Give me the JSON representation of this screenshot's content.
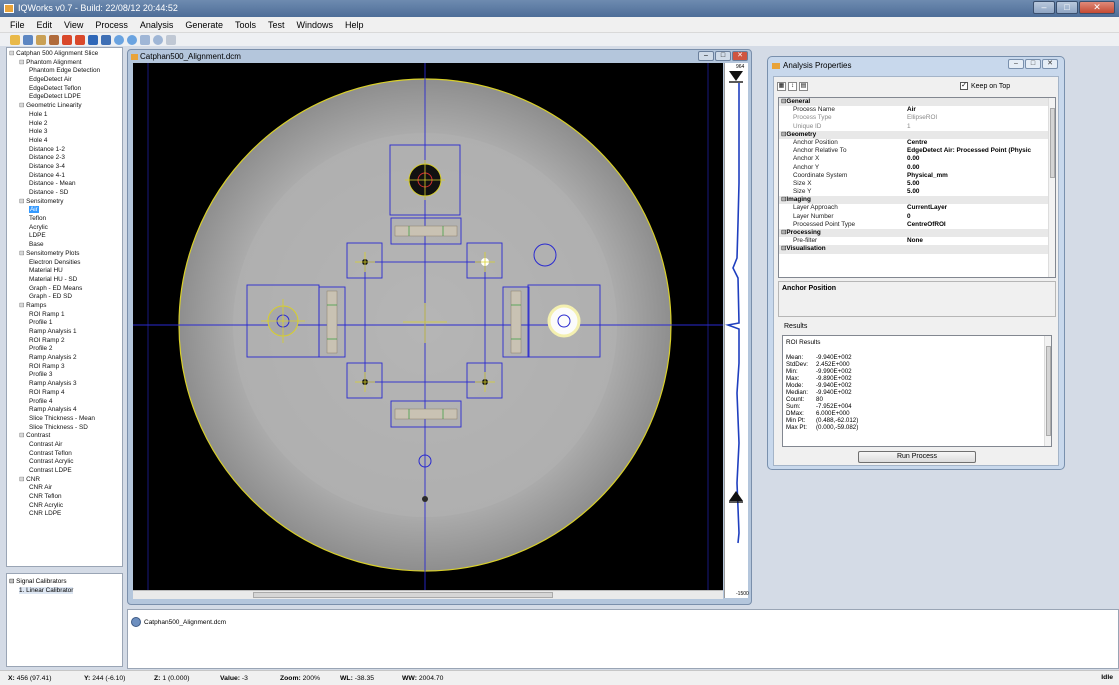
{
  "window": {
    "title": "IQWorks v0.7 - Build: 22/08/12 20:44:52"
  },
  "menu": [
    "File",
    "Edit",
    "View",
    "Process",
    "Analysis",
    "Generate",
    "Tools",
    "Test",
    "Windows",
    "Help"
  ],
  "tree": [
    {
      "label": "Catphan 500 Alignment Slice",
      "level": 0,
      "exp": true
    },
    {
      "label": "Phantom Alignment",
      "level": 1,
      "exp": true
    },
    {
      "label": "Phantom Edge Detection",
      "level": 2
    },
    {
      "label": "EdgeDetect Air",
      "level": 2
    },
    {
      "label": "EdgeDetect Teflon",
      "level": 2
    },
    {
      "label": "EdgeDetect LDPE",
      "level": 2
    },
    {
      "label": "Geometric Linearity",
      "level": 1,
      "exp": true
    },
    {
      "label": "Hole 1",
      "level": 2
    },
    {
      "label": "Hole 2",
      "level": 2
    },
    {
      "label": "Hole 3",
      "level": 2
    },
    {
      "label": "Hole 4",
      "level": 2
    },
    {
      "label": "Distance 1-2",
      "level": 2
    },
    {
      "label": "Distance 2-3",
      "level": 2
    },
    {
      "label": "Distance 3-4",
      "level": 2
    },
    {
      "label": "Distance 4-1",
      "level": 2
    },
    {
      "label": "Distance - Mean",
      "level": 2
    },
    {
      "label": "Distance - SD",
      "level": 2
    },
    {
      "label": "Sensitometry",
      "level": 1,
      "exp": true
    },
    {
      "label": "Air",
      "level": 2,
      "sel": true
    },
    {
      "label": "Teflon",
      "level": 2
    },
    {
      "label": "Acrylic",
      "level": 2
    },
    {
      "label": "LDPE",
      "level": 2
    },
    {
      "label": "Base",
      "level": 2
    },
    {
      "label": "Sensitometry Plots",
      "level": 1,
      "exp": true
    },
    {
      "label": "Electron Densities",
      "level": 2
    },
    {
      "label": "Material HU",
      "level": 2
    },
    {
      "label": "Material HU - SD",
      "level": 2
    },
    {
      "label": "Graph - ED Means",
      "level": 2
    },
    {
      "label": "Graph - ED SD",
      "level": 2
    },
    {
      "label": "Ramps",
      "level": 1,
      "exp": true
    },
    {
      "label": "ROI Ramp 1",
      "level": 2
    },
    {
      "label": "Profile 1",
      "level": 2
    },
    {
      "label": "Ramp Analysis 1",
      "level": 2
    },
    {
      "label": "ROI Ramp 2",
      "level": 2
    },
    {
      "label": "Profile 2",
      "level": 2
    },
    {
      "label": "Ramp Analysis 2",
      "level": 2
    },
    {
      "label": "ROI Ramp 3",
      "level": 2
    },
    {
      "label": "Profile 3",
      "level": 2
    },
    {
      "label": "Ramp Analysis 3",
      "level": 2
    },
    {
      "label": "ROI Ramp 4",
      "level": 2
    },
    {
      "label": "Profile 4",
      "level": 2
    },
    {
      "label": "Ramp Analysis 4",
      "level": 2
    },
    {
      "label": "Slice Thickness - Mean",
      "level": 2
    },
    {
      "label": "Slice Thickness - SD",
      "level": 2
    },
    {
      "label": "Contrast",
      "level": 1,
      "exp": true
    },
    {
      "label": "Contrast Air",
      "level": 2
    },
    {
      "label": "Contrast Teflon",
      "level": 2
    },
    {
      "label": "Contrast Acrylic",
      "level": 2
    },
    {
      "label": "Contrast LDPE",
      "level": 2
    },
    {
      "label": "CNR",
      "level": 1,
      "exp": true
    },
    {
      "label": "CNR Air",
      "level": 2
    },
    {
      "label": "CNR Teflon",
      "level": 2
    },
    {
      "label": "CNR Acrylic",
      "level": 2
    },
    {
      "label": "CNR LDPE",
      "level": 2
    }
  ],
  "calibrators": {
    "root": "Signal Calibrators",
    "item": "1. Linear Calibrator"
  },
  "image_window": {
    "title": "Catphan500_Alignment.dcm",
    "profile_top": "964",
    "profile_bottom": "-1500"
  },
  "analysis": {
    "title": "Analysis Properties",
    "keep_on_top": "Keep on Top",
    "rows": [
      {
        "cat": "General"
      },
      {
        "k": "Process Name",
        "v": "Air"
      },
      {
        "k": "Process Type",
        "v": "EllipseROI",
        "dis": true
      },
      {
        "k": "Unique ID",
        "v": "1",
        "dis": true
      },
      {
        "cat": "Geometry"
      },
      {
        "k": "Anchor Position",
        "v": "Centre"
      },
      {
        "k": "Anchor Relative To",
        "v": "EdgeDetect Air: Processed Point (Physic"
      },
      {
        "k": "Anchor X",
        "v": "0.00"
      },
      {
        "k": "Anchor Y",
        "v": "0.00"
      },
      {
        "k": "Coordinate System",
        "v": "Physical_mm"
      },
      {
        "k": "Size X",
        "v": "5.00"
      },
      {
        "k": "Size Y",
        "v": "5.00"
      },
      {
        "cat": "Imaging"
      },
      {
        "k": "Layer Approach",
        "v": "CurrentLayer"
      },
      {
        "k": "Layer Number",
        "v": "0"
      },
      {
        "k": "Processed Point Type",
        "v": "CentreOfROI"
      },
      {
        "cat": "Processing"
      },
      {
        "k": "Pre-filter",
        "v": "None"
      },
      {
        "cat": "Visualisation"
      }
    ],
    "description": "Anchor Position",
    "results_label": "Results",
    "results_header": "ROI Results",
    "results": [
      {
        "k": "Mean:",
        "v": "-9.940E+002"
      },
      {
        "k": "StdDev:",
        "v": "2.452E+000"
      },
      {
        "k": "Min:",
        "v": "-9.990E+002"
      },
      {
        "k": "Max:",
        "v": "-9.890E+002"
      },
      {
        "k": "Mode:",
        "v": "-9.940E+002"
      },
      {
        "k": "Median:",
        "v": "-9.940E+002"
      },
      {
        "k": "Count:",
        "v": "80"
      },
      {
        "k": "Sum:",
        "v": "-7.952E+004"
      },
      {
        "k": "DMax:",
        "v": "6.000E+000"
      },
      {
        "k": "Min Pt:",
        "v": "(0.488,-62.012)"
      },
      {
        "k": "Max Pt:",
        "v": "(0.000,-59.082)"
      }
    ],
    "run_button": "Run Process"
  },
  "file_panel": {
    "name": "Catphan500_Alignment.dcm"
  },
  "status": {
    "x": {
      "label": "X:",
      "value": "456 (97.41)"
    },
    "y": {
      "label": "Y:",
      "value": "244 (-6.10)"
    },
    "z": {
      "label": "Z:",
      "value": "1 (0.000)"
    },
    "value": {
      "label": "Value:",
      "value": "-3"
    },
    "zoom": {
      "label": "Zoom:",
      "value": "200%"
    },
    "wl": {
      "label": "WL:",
      "value": "-38.35"
    },
    "ww": {
      "label": "WW:",
      "value": "2004.70"
    },
    "state": "Idle"
  }
}
